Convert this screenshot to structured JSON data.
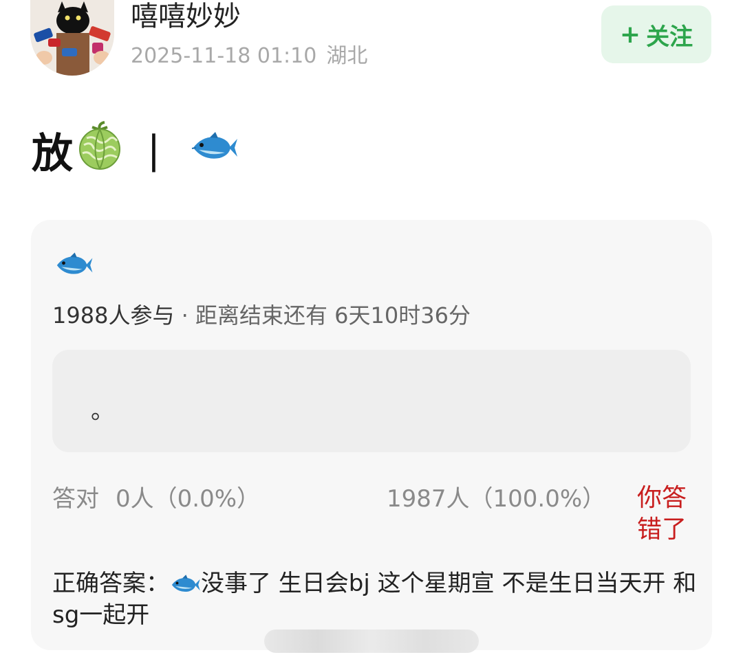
{
  "author": {
    "name": "嘻嘻妙妙",
    "time": "2025-11-18 01:10",
    "location": "湖北"
  },
  "follow_button": {
    "plus": "+",
    "label": "关注"
  },
  "post": {
    "title_text": "放",
    "separator": "|",
    "title_icons": [
      "melon-emoji",
      "fish-emoji"
    ]
  },
  "quiz": {
    "icon": "fish-emoji",
    "participants": "1988人参与",
    "dot": "·",
    "countdown": "距离结束还有 6天10时36分",
    "option_text": "。",
    "correct_label": "答对",
    "correct_stats": "0人（0.0%）",
    "wrong_stats": "1987人（100.0%）",
    "your_result": "你答错了",
    "answer_label": "正确答案：",
    "answer_text": "没事了 生日会bj 这个星期宣 不是生日当天开 和sg一起开"
  },
  "colors": {
    "follow_bg": "#e6f6ea",
    "follow_text": "#2da54c",
    "wrong_text": "#c81e1e",
    "card_bg": "#f7f7f7"
  }
}
